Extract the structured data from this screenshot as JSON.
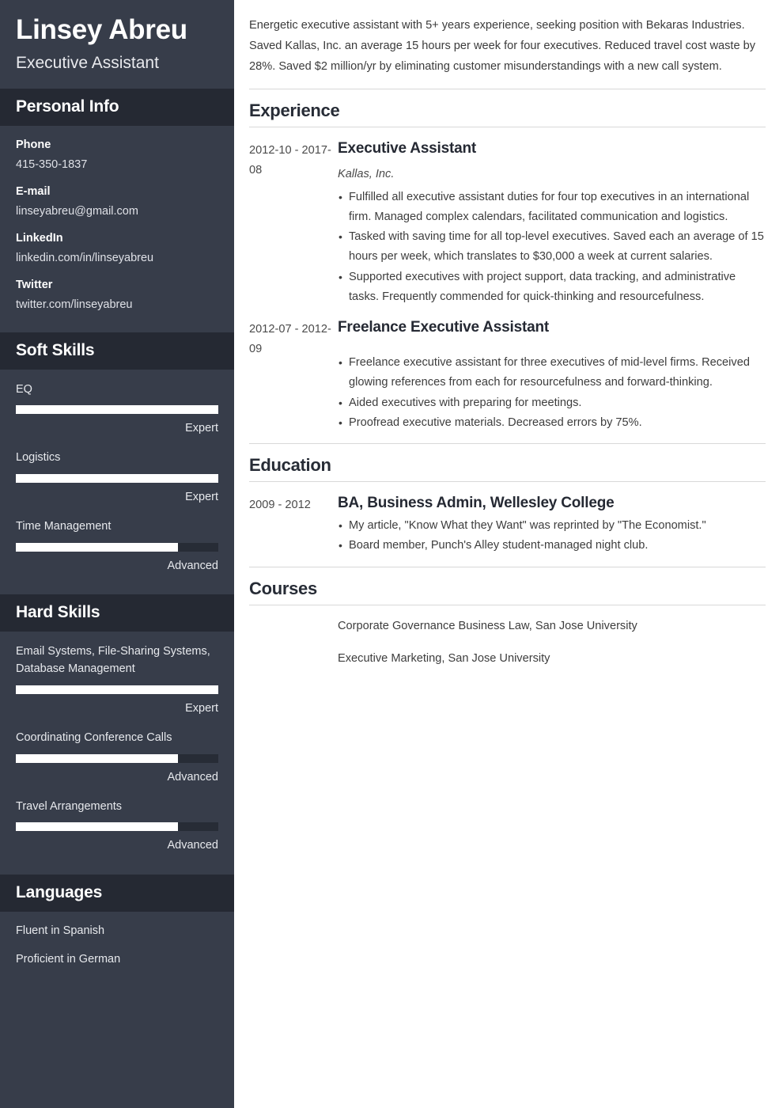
{
  "sidebar": {
    "name": "Linsey Abreu",
    "role": "Executive Assistant",
    "personal_info": {
      "title": "Personal Info",
      "items": [
        {
          "label": "Phone",
          "value": "415-350-1837"
        },
        {
          "label": "E-mail",
          "value": "linseyabreu@gmail.com"
        },
        {
          "label": "LinkedIn",
          "value": "linkedin.com/in/linseyabreu"
        },
        {
          "label": "Twitter",
          "value": "twitter.com/linseyabreu"
        }
      ]
    },
    "soft_skills": {
      "title": "Soft Skills",
      "items": [
        {
          "name": "EQ",
          "level": "Expert",
          "percent": 100
        },
        {
          "name": "Logistics",
          "level": "Expert",
          "percent": 100
        },
        {
          "name": "Time Management",
          "level": "Advanced",
          "percent": 80
        }
      ]
    },
    "hard_skills": {
      "title": "Hard Skills",
      "items": [
        {
          "name": "Email Systems, File-Sharing Systems, Database Management",
          "level": "Expert",
          "percent": 100
        },
        {
          "name": "Coordinating Conference Calls",
          "level": "Advanced",
          "percent": 80
        },
        {
          "name": "Travel Arrangements",
          "level": "Advanced",
          "percent": 80
        }
      ]
    },
    "languages": {
      "title": "Languages",
      "items": [
        "Fluent in Spanish",
        "Proficient in German"
      ]
    }
  },
  "main": {
    "summary": "Energetic executive assistant with 5+ years experience, seeking position with Bekaras Industries. Saved Kallas, Inc. an average 15 hours per week for four executives. Reduced travel cost waste by 28%. Saved $2 million/yr by eliminating customer misunderstandings with a new call system.",
    "experience": {
      "title": "Experience",
      "entries": [
        {
          "date": "2012-10 - 2017-08",
          "title": "Executive Assistant",
          "company": "Kallas, Inc.",
          "bullets": [
            "Fulfilled all executive assistant duties for four top executives in an international firm. Managed complex calendars, facilitated communication and logistics.",
            "Tasked with saving time for all top-level executives. Saved each an average of 15 hours per week, which translates to $30,000 a week at current salaries.",
            "Supported executives with project support, data tracking, and administrative tasks. Frequently commended for quick-thinking and resourcefulness."
          ]
        },
        {
          "date": "2012-07 - 2012-09",
          "title": "Freelance Executive Assistant",
          "company": "",
          "bullets": [
            "Freelance executive assistant for three executives of mid-level firms. Received glowing references from each for resourcefulness and forward-thinking.",
            "Aided executives with preparing for meetings.",
            "Proofread executive materials. Decreased errors by 75%."
          ]
        }
      ]
    },
    "education": {
      "title": "Education",
      "entries": [
        {
          "date": "2009 - 2012",
          "title": "BA, Business Admin, Wellesley College",
          "bullets": [
            "My article, \"Know What they Want\" was reprinted by \"The Economist.\"",
            "Board member, Punch's Alley student-managed night club."
          ]
        }
      ]
    },
    "courses": {
      "title": "Courses",
      "items": [
        "Corporate Governance Business Law, San Jose University",
        "Executive Marketing, San Jose University"
      ]
    }
  }
}
